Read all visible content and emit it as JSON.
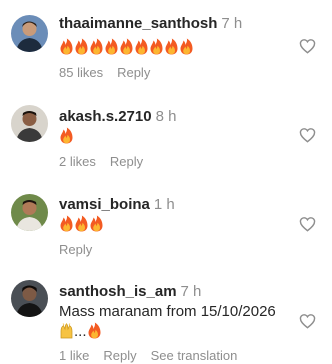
{
  "comments": [
    {
      "username": "thaaimanne_santhosh",
      "time": "7 h",
      "flame_count": 9,
      "likes": "85 likes",
      "reply": "Reply"
    },
    {
      "username": "akash.s.2710",
      "time": "8 h",
      "flame_count": 1,
      "likes": "2 likes",
      "reply": "Reply"
    },
    {
      "username": "vamsi_boina",
      "time": "1 h",
      "flame_count": 3,
      "likes": "",
      "reply": "Reply"
    },
    {
      "username": "santhosh_is_am",
      "time": "7 h",
      "text": "Mass maranam from 15/10/2026",
      "text_suffix": "...",
      "likes": "1 like",
      "reply": "Reply",
      "see_translation": "See translation"
    }
  ],
  "icons": {
    "flame": "fire-emoji",
    "heart": "heart-outline-icon",
    "hands": "raised-hands-emoji"
  },
  "colors": {
    "secondary_text": "#8e8e8e",
    "primary_text": "#262626"
  }
}
